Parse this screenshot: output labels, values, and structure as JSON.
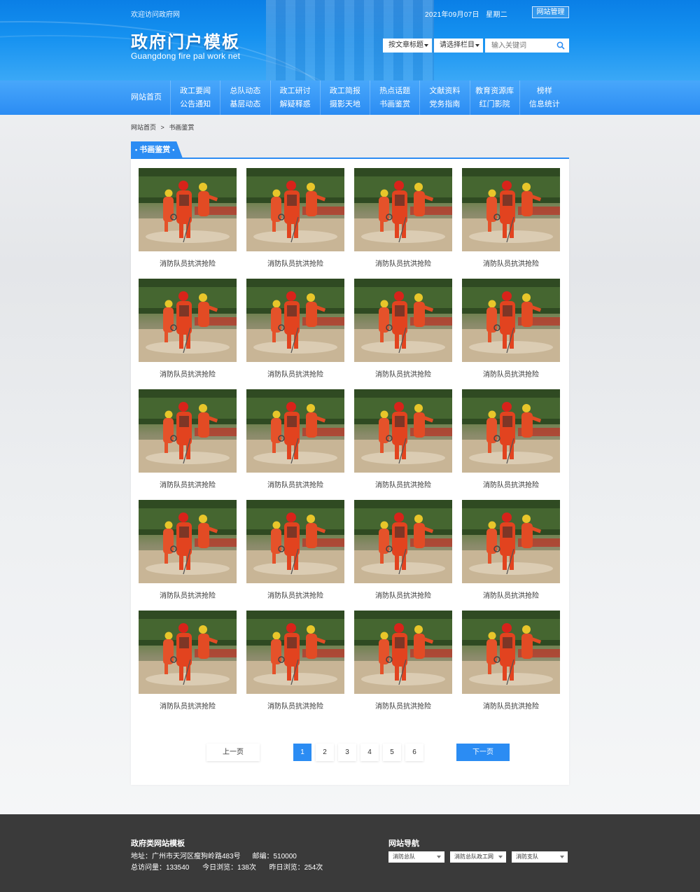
{
  "top": {
    "welcome": "欢迎访问政府网",
    "date": "2021年09月07日",
    "weekday": "星期二",
    "manage_label": "网站管理"
  },
  "logo": {
    "title": "政府门户模板",
    "subtitle": "Guangdong fire pal work net"
  },
  "search": {
    "select_article": "按文章标题",
    "select_column": "请选择栏目",
    "placeholder": "输入关键词",
    "icon": "search-icon"
  },
  "nav": {
    "home": "网站首页",
    "columns": [
      [
        "政工要闻",
        "公告通知"
      ],
      [
        "总队动态",
        "基层动态"
      ],
      [
        "政工研讨",
        "解疑释惑"
      ],
      [
        "政工简报",
        "摄影天地"
      ],
      [
        "热点话题",
        "书画鉴赏"
      ],
      [
        "文献资料",
        "党务指南"
      ],
      [
        "教育资源库",
        "红门影院"
      ],
      [
        "榜样",
        "信息统计"
      ]
    ]
  },
  "breadcrumb": {
    "home": "网站首页",
    "sep": ">",
    "current": "书画鉴赏"
  },
  "section": {
    "title": "书画鉴赏"
  },
  "gallery": {
    "items": [
      "消防队员抗洪抢险",
      "消防队员抗洪抢险",
      "消防队员抗洪抢险",
      "消防队员抗洪抢险",
      "消防队员抗洪抢险",
      "消防队员抗洪抢险",
      "消防队员抗洪抢险",
      "消防队员抗洪抢险",
      "消防队员抗洪抢险",
      "消防队员抗洪抢险",
      "消防队员抗洪抢险",
      "消防队员抗洪抢险",
      "消防队员抗洪抢险",
      "消防队员抗洪抢险",
      "消防队员抗洪抢险",
      "消防队员抗洪抢险",
      "消防队员抗洪抢险",
      "消防队员抗洪抢险",
      "消防队员抗洪抢险",
      "消防队员抗洪抢险"
    ]
  },
  "pager": {
    "prev": "上一页",
    "next": "下一页",
    "pages": [
      "1",
      "2",
      "3",
      "4",
      "5",
      "6"
    ],
    "current": "1"
  },
  "footer": {
    "title": "政府类网站模板",
    "address": "地址：广州市天河区瘦狗岭路483号",
    "postcode": "邮编：510000",
    "total_visits": "总访问量：133540",
    "today_visits": "今日浏览：138次",
    "yesterday_visits": "昨日浏览：254次",
    "nav_title": "网站导航",
    "nav_selects": [
      "消防总队",
      "消防总队政工网",
      "消防支队"
    ]
  },
  "colors": {
    "primary": "#2b8cf3",
    "header_top": "#0a7fe6",
    "footer_bg": "#3a3a3a"
  }
}
